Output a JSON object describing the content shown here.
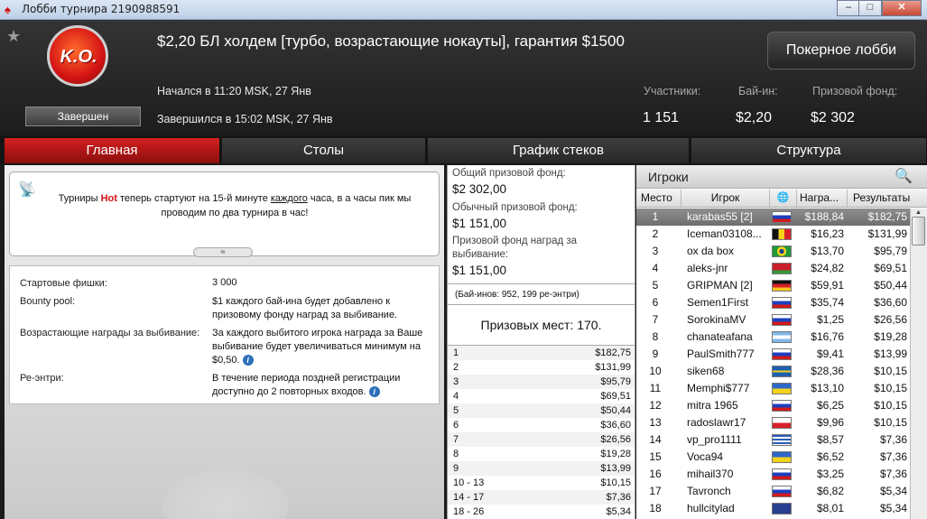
{
  "window": {
    "title": "Лобби турнира 2190988591",
    "minimize": "‒",
    "maximize": "□",
    "close": "✕"
  },
  "header": {
    "logo_text": "K.O.",
    "status": "Завершен",
    "title": "$2,20 БЛ холдем [турбо, возрастающие нокауты], гарантия $1500",
    "started": "Начался в 11:20 MSK, 27 Янв",
    "finished": "Завершился в 15:02 MSK, 27 Янв",
    "lobby_button": "Покерное лобби",
    "stats": {
      "players_label": "Участники:",
      "players_value": "1 151",
      "buyin_label": "Бай-ин:",
      "buyin_value": "$2,20",
      "prize_label": "Призовой фонд:",
      "prize_value": "$2 302"
    }
  },
  "tabs": [
    "Главная",
    "Столы",
    "График стеков",
    "Структура"
  ],
  "news": {
    "line1_a": "Турниры ",
    "line1_hot": "Hot",
    "line1_b": " теперь стартуют на 15-й минуте ",
    "line1_u": "каждого",
    "line1_c": " часа, в а часы пик мы",
    "line2": "проводим по два турнира в час!",
    "collapse": "≈"
  },
  "info": {
    "rows": [
      {
        "label": "Стартовые фишки:",
        "value": "3 000"
      },
      {
        "label": "Bounty pool:",
        "value": "$1 каждого бай-ина будет добавлено к призовому фонду наград за выбивание."
      },
      {
        "label": "Возрастающие награды за выбивание:",
        "value": "За каждого выбитого игрока награда за Ваше выбивание будет увеличиваться минимум на $0,50."
      },
      {
        "label": "Ре-энтри:",
        "value": "В течение периода поздней регистрации доступно до 2 повторных входов."
      }
    ],
    "info_glyph": "i"
  },
  "prize": {
    "total_label": "Общий призовой фонд:",
    "total_value": "$2 302,00",
    "regular_label": "Обычный призовой фонд:",
    "regular_value": "$1 151,00",
    "bounty_label_1": "Призовой фонд наград за",
    "bounty_label_2": "выбивание:",
    "bounty_value": "$1 151,00",
    "entries": "(Бай-инов: 952, 199 ре-энтри)",
    "paid_places": "Призовых мест: 170.",
    "payouts": [
      [
        "1",
        "$182,75"
      ],
      [
        "2",
        "$131,99"
      ],
      [
        "3",
        "$95,79"
      ],
      [
        "4",
        "$69,51"
      ],
      [
        "5",
        "$50,44"
      ],
      [
        "6",
        "$36,60"
      ],
      [
        "7",
        "$26,56"
      ],
      [
        "8",
        "$19,28"
      ],
      [
        "9",
        "$13,99"
      ],
      [
        "10 - 13",
        "$10,15"
      ],
      [
        "14 - 17",
        "$7,36"
      ],
      [
        "18 - 26",
        "$5,34"
      ]
    ]
  },
  "players": {
    "title": "Игроки",
    "columns": [
      "Место",
      "Игрок",
      "🌐",
      "Награ...",
      "Результаты"
    ],
    "rows": [
      {
        "place": "1",
        "name": "karabas55 [2]",
        "flag": "ru",
        "bounty": "$188,84",
        "result": "$182,75"
      },
      {
        "place": "2",
        "name": "Iceman03108...",
        "flag": "be",
        "bounty": "$16,23",
        "result": "$131,99"
      },
      {
        "place": "3",
        "name": "ox da box",
        "flag": "br",
        "bounty": "$13,70",
        "result": "$95,79"
      },
      {
        "place": "4",
        "name": "aleks-jnr",
        "flag": "by",
        "bounty": "$24,82",
        "result": "$69,51"
      },
      {
        "place": "5",
        "name": "GRIPMAN [2]",
        "flag": "de",
        "bounty": "$59,91",
        "result": "$50,44"
      },
      {
        "place": "6",
        "name": "Semen1First",
        "flag": "ru",
        "bounty": "$35,74",
        "result": "$36,60"
      },
      {
        "place": "7",
        "name": "SorokinaMV",
        "flag": "ru",
        "bounty": "$1,25",
        "result": "$26,56"
      },
      {
        "place": "8",
        "name": "chanateafana",
        "flag": "ar",
        "bounty": "$16,76",
        "result": "$19,28"
      },
      {
        "place": "9",
        "name": "PaulSmith777",
        "flag": "ru",
        "bounty": "$9,41",
        "result": "$13,99"
      },
      {
        "place": "10",
        "name": "siken68",
        "flag": "se",
        "bounty": "$28,36",
        "result": "$10,15"
      },
      {
        "place": "11",
        "name": "Memphi$777",
        "flag": "ua",
        "bounty": "$13,10",
        "result": "$10,15"
      },
      {
        "place": "12",
        "name": "mitra 1965",
        "flag": "ru",
        "bounty": "$6,25",
        "result": "$10,15"
      },
      {
        "place": "13",
        "name": "radoslawr17",
        "flag": "pl",
        "bounty": "$9,96",
        "result": "$10,15"
      },
      {
        "place": "14",
        "name": "vp_pro1111",
        "flag": "gr",
        "bounty": "$8,57",
        "result": "$7,36"
      },
      {
        "place": "15",
        "name": "Voca94",
        "flag": "ua",
        "bounty": "$6,52",
        "result": "$7,36"
      },
      {
        "place": "16",
        "name": "mihail370",
        "flag": "ru",
        "bounty": "$3,25",
        "result": "$7,36"
      },
      {
        "place": "17",
        "name": "Tavronch",
        "flag": "ru",
        "bounty": "$6,82",
        "result": "$5,34"
      },
      {
        "place": "18",
        "name": "hullcitylad",
        "flag": "gb",
        "bounty": "$8,01",
        "result": "$5,34"
      }
    ]
  },
  "flag_styles": {
    "ru": "linear-gradient(#ffffff 33%, #1c3fbf 33% 66%, #d21a1a 66%)",
    "be": "linear-gradient(90deg, #111111 33%, #f6d21b 33% 66%, #d8202a 66%)",
    "br": "radial-gradient(circle, #1a3a8c 22%, #f2d21b 23% 45%, #1f9a3a 46%)",
    "by": "linear-gradient(#c8202a 66%, #2f9a3a 66%)",
    "de": "linear-gradient(#111111 33%, #d8202a 33% 66%, #f6c61b 66%)",
    "ar": "linear-gradient(#7fb8e8 33%, #ffffff 33% 66%, #7fb8e8 66%)",
    "se": "linear-gradient(#1f5fb0 40%, #f2cf1b 40% 60%, #1f5fb0 60%)",
    "ua": "linear-gradient(#2f67c8 50%, #f2d21b 50%)",
    "pl": "linear-gradient(#ffffff 50%, #d8202a 50%)",
    "gr": "repeating-linear-gradient(#2a5fb8 0 2px, #ffffff 2px 4px)",
    "gb": "linear-gradient(#2a3f8f, #2a3f8f)"
  }
}
